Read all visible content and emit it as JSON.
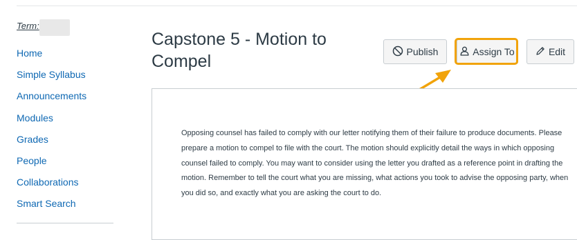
{
  "sidebar": {
    "term_label": "Term:",
    "items": [
      {
        "label": "Home"
      },
      {
        "label": "Simple Syllabus"
      },
      {
        "label": "Announcements"
      },
      {
        "label": "Modules"
      },
      {
        "label": "Grades"
      },
      {
        "label": "People"
      },
      {
        "label": "Collaborations"
      },
      {
        "label": "Smart Search"
      }
    ]
  },
  "page": {
    "title": "Capstone 5 - Motion to Compel"
  },
  "toolbar": {
    "publish_label": "Publish",
    "assign_label": "Assign To",
    "edit_label": "Edit"
  },
  "content": {
    "body": "Opposing counsel has failed to comply with our letter notifying them of their failure to produce documents. Please prepare a motion to compel to file with the court. The motion should explicitly detail the ways in which opposing counsel failed to comply. You may want to consider using the letter you drafted as a reference point in drafting the motion.  Remember to tell the court what you are missing, what actions you took to advise the opposing party, when you did so, and exactly what you are asking the court to do."
  },
  "icons": {
    "publish": "unpublished-circle-icon",
    "assign": "user-icon",
    "edit": "pencil-icon"
  },
  "colors": {
    "link": "#0e68b3",
    "highlight": "#f1a30a",
    "text": "#2d3b45"
  }
}
